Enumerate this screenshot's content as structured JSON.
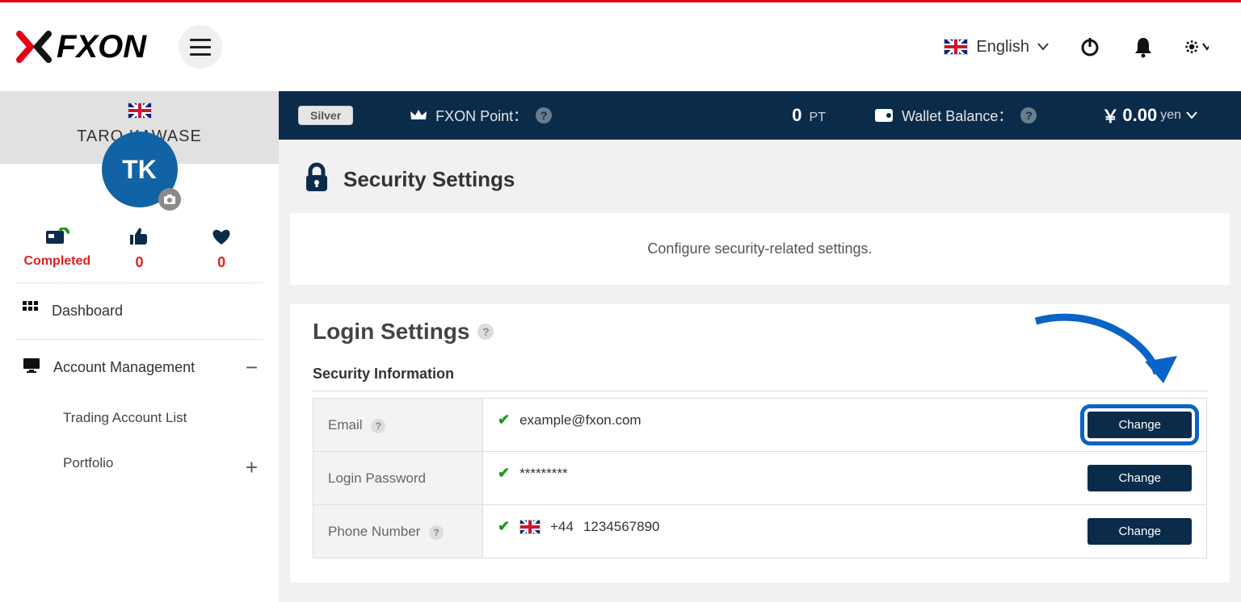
{
  "header": {
    "brand": "FXON",
    "language": "English"
  },
  "sidebar": {
    "user_name": "TARO KAWASE",
    "avatar_initials": "TK",
    "status": {
      "completed_label": "Completed",
      "likes": "0",
      "hearts": "0"
    },
    "menu": {
      "dashboard": "Dashboard",
      "account_mgmt": "Account Management",
      "trading_list": "Trading Account List",
      "portfolio": "Portfolio"
    }
  },
  "infobar": {
    "tier": "Silver",
    "point_label": "FXON Point：",
    "point_value": "0",
    "point_unit": "PT",
    "wallet_label": "Wallet Balance：",
    "wallet_currency": "￥",
    "wallet_value": "0.00",
    "wallet_unit": "yen"
  },
  "page": {
    "title": "Security Settings",
    "description": "Configure security-related settings."
  },
  "login": {
    "title": "Login Settings",
    "subheading": "Security Information",
    "rows": {
      "email": {
        "label": "Email",
        "value": "example@fxon.com",
        "button": "Change"
      },
      "password": {
        "label": "Login Password",
        "value": "*********",
        "button": "Change"
      },
      "phone": {
        "label": "Phone Number",
        "prefix": "+44",
        "value": "1234567890",
        "button": "Change"
      }
    }
  }
}
